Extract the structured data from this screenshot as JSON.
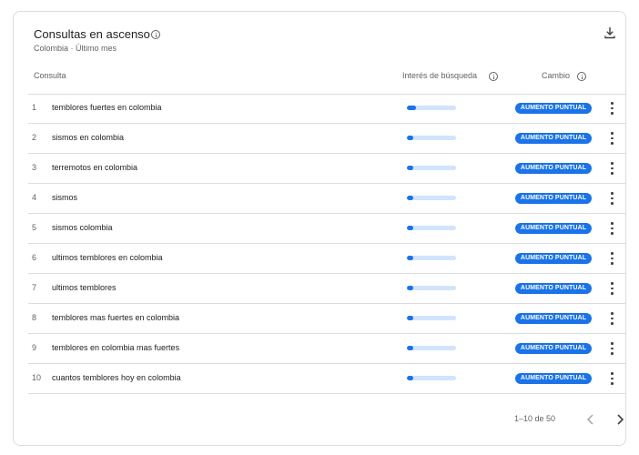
{
  "card": {
    "title": "Consultas en ascenso",
    "subtitle": "Colombia · Último mes",
    "download_icon": "download-icon",
    "info_icon": "info-icon"
  },
  "table": {
    "headers": {
      "consulta": "Consulta",
      "interes": "Interés de búsqueda",
      "cambio": "Cambio"
    },
    "rows": [
      {
        "rank": "1",
        "query": "temblores fuertes en colombia",
        "interest": 0.18,
        "change": "AUMENTO PUNTUAL"
      },
      {
        "rank": "2",
        "query": "sismos en colombia",
        "interest": 0.13,
        "change": "AUMENTO PUNTUAL"
      },
      {
        "rank": "3",
        "query": "terremotos en colombia",
        "interest": 0.13,
        "change": "AUMENTO PUNTUAL"
      },
      {
        "rank": "4",
        "query": "sismos",
        "interest": 0.13,
        "change": "AUMENTO PUNTUAL"
      },
      {
        "rank": "5",
        "query": "sismos colombia",
        "interest": 0.13,
        "change": "AUMENTO PUNTUAL"
      },
      {
        "rank": "6",
        "query": "ultimos temblores en colombia",
        "interest": 0.13,
        "change": "AUMENTO PUNTUAL"
      },
      {
        "rank": "7",
        "query": "ultimos temblores",
        "interest": 0.13,
        "change": "AUMENTO PUNTUAL"
      },
      {
        "rank": "8",
        "query": "temblores mas fuertes en colombia",
        "interest": 0.13,
        "change": "AUMENTO PUNTUAL"
      },
      {
        "rank": "9",
        "query": "temblores en colombia mas fuertes",
        "interest": 0.13,
        "change": "AUMENTO PUNTUAL"
      },
      {
        "rank": "10",
        "query": "cuantos temblores hoy en colombia",
        "interest": 0.13,
        "change": "AUMENTO PUNTUAL"
      }
    ]
  },
  "pagination": {
    "label": "1–10 de 50",
    "prev_icon": "chevron-left-icon",
    "next_icon": "chevron-right-icon"
  },
  "colors": {
    "accent": "#1a73e8",
    "bar_track": "#d2e3fc",
    "border": "#dadce0"
  }
}
